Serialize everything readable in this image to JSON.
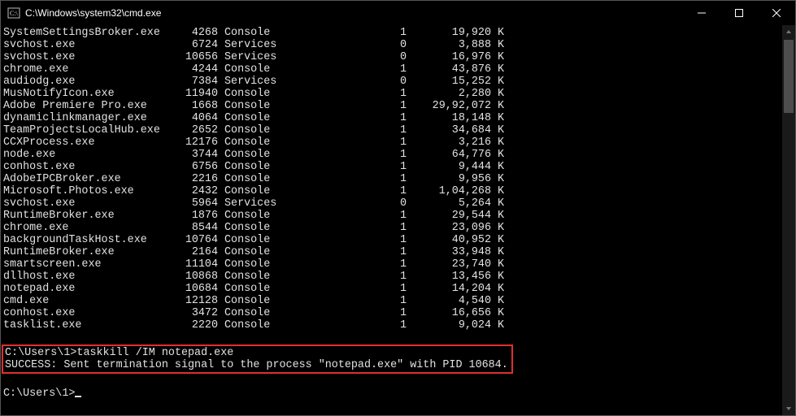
{
  "window": {
    "title": "C:\\Windows\\system32\\cmd.exe"
  },
  "processes": [
    {
      "name": "SystemSettingsBroker.exe",
      "pid": "4268",
      "session_name": "Console",
      "session_num": "1",
      "mem": "19,920",
      "unit": "K"
    },
    {
      "name": "svchost.exe",
      "pid": "6724",
      "session_name": "Services",
      "session_num": "0",
      "mem": "3,888",
      "unit": "K"
    },
    {
      "name": "svchost.exe",
      "pid": "10656",
      "session_name": "Services",
      "session_num": "0",
      "mem": "16,976",
      "unit": "K"
    },
    {
      "name": "chrome.exe",
      "pid": "4244",
      "session_name": "Console",
      "session_num": "1",
      "mem": "43,876",
      "unit": "K"
    },
    {
      "name": "audiodg.exe",
      "pid": "7384",
      "session_name": "Services",
      "session_num": "0",
      "mem": "15,252",
      "unit": "K"
    },
    {
      "name": "MusNotifyIcon.exe",
      "pid": "11940",
      "session_name": "Console",
      "session_num": "1",
      "mem": "2,280",
      "unit": "K"
    },
    {
      "name": "Adobe Premiere Pro.exe",
      "pid": "1668",
      "session_name": "Console",
      "session_num": "1",
      "mem": "29,92,072",
      "unit": "K"
    },
    {
      "name": "dynamiclinkmanager.exe",
      "pid": "4064",
      "session_name": "Console",
      "session_num": "1",
      "mem": "18,148",
      "unit": "K"
    },
    {
      "name": "TeamProjectsLocalHub.exe",
      "pid": "2652",
      "session_name": "Console",
      "session_num": "1",
      "mem": "34,684",
      "unit": "K"
    },
    {
      "name": "CCXProcess.exe",
      "pid": "12176",
      "session_name": "Console",
      "session_num": "1",
      "mem": "3,216",
      "unit": "K"
    },
    {
      "name": "node.exe",
      "pid": "3744",
      "session_name": "Console",
      "session_num": "1",
      "mem": "64,776",
      "unit": "K"
    },
    {
      "name": "conhost.exe",
      "pid": "6756",
      "session_name": "Console",
      "session_num": "1",
      "mem": "9,444",
      "unit": "K"
    },
    {
      "name": "AdobeIPCBroker.exe",
      "pid": "2216",
      "session_name": "Console",
      "session_num": "1",
      "mem": "9,956",
      "unit": "K"
    },
    {
      "name": "Microsoft.Photos.exe",
      "pid": "2432",
      "session_name": "Console",
      "session_num": "1",
      "mem": "1,04,268",
      "unit": "K"
    },
    {
      "name": "svchost.exe",
      "pid": "5964",
      "session_name": "Services",
      "session_num": "0",
      "mem": "5,264",
      "unit": "K"
    },
    {
      "name": "RuntimeBroker.exe",
      "pid": "1876",
      "session_name": "Console",
      "session_num": "1",
      "mem": "29,544",
      "unit": "K"
    },
    {
      "name": "chrome.exe",
      "pid": "8544",
      "session_name": "Console",
      "session_num": "1",
      "mem": "23,096",
      "unit": "K"
    },
    {
      "name": "backgroundTaskHost.exe",
      "pid": "10764",
      "session_name": "Console",
      "session_num": "1",
      "mem": "40,952",
      "unit": "K"
    },
    {
      "name": "RuntimeBroker.exe",
      "pid": "2164",
      "session_name": "Console",
      "session_num": "1",
      "mem": "33,948",
      "unit": "K"
    },
    {
      "name": "smartscreen.exe",
      "pid": "11104",
      "session_name": "Console",
      "session_num": "1",
      "mem": "23,740",
      "unit": "K"
    },
    {
      "name": "dllhost.exe",
      "pid": "10868",
      "session_name": "Console",
      "session_num": "1",
      "mem": "13,456",
      "unit": "K"
    },
    {
      "name": "notepad.exe",
      "pid": "10684",
      "session_name": "Console",
      "session_num": "1",
      "mem": "14,204",
      "unit": "K"
    },
    {
      "name": "cmd.exe",
      "pid": "12128",
      "session_name": "Console",
      "session_num": "1",
      "mem": "4,540",
      "unit": "K"
    },
    {
      "name": "conhost.exe",
      "pid": "3472",
      "session_name": "Console",
      "session_num": "1",
      "mem": "16,656",
      "unit": "K"
    },
    {
      "name": "tasklist.exe",
      "pid": "2220",
      "session_name": "Console",
      "session_num": "1",
      "mem": "9,024",
      "unit": "K"
    }
  ],
  "command": {
    "prompt1": "C:\\Users\\1>",
    "cmd_text": "taskkill /IM notepad.exe",
    "result": "SUCCESS: Sent termination signal to the process \"notepad.exe\" with PID 10684.",
    "prompt2": "C:\\Users\\1>"
  }
}
